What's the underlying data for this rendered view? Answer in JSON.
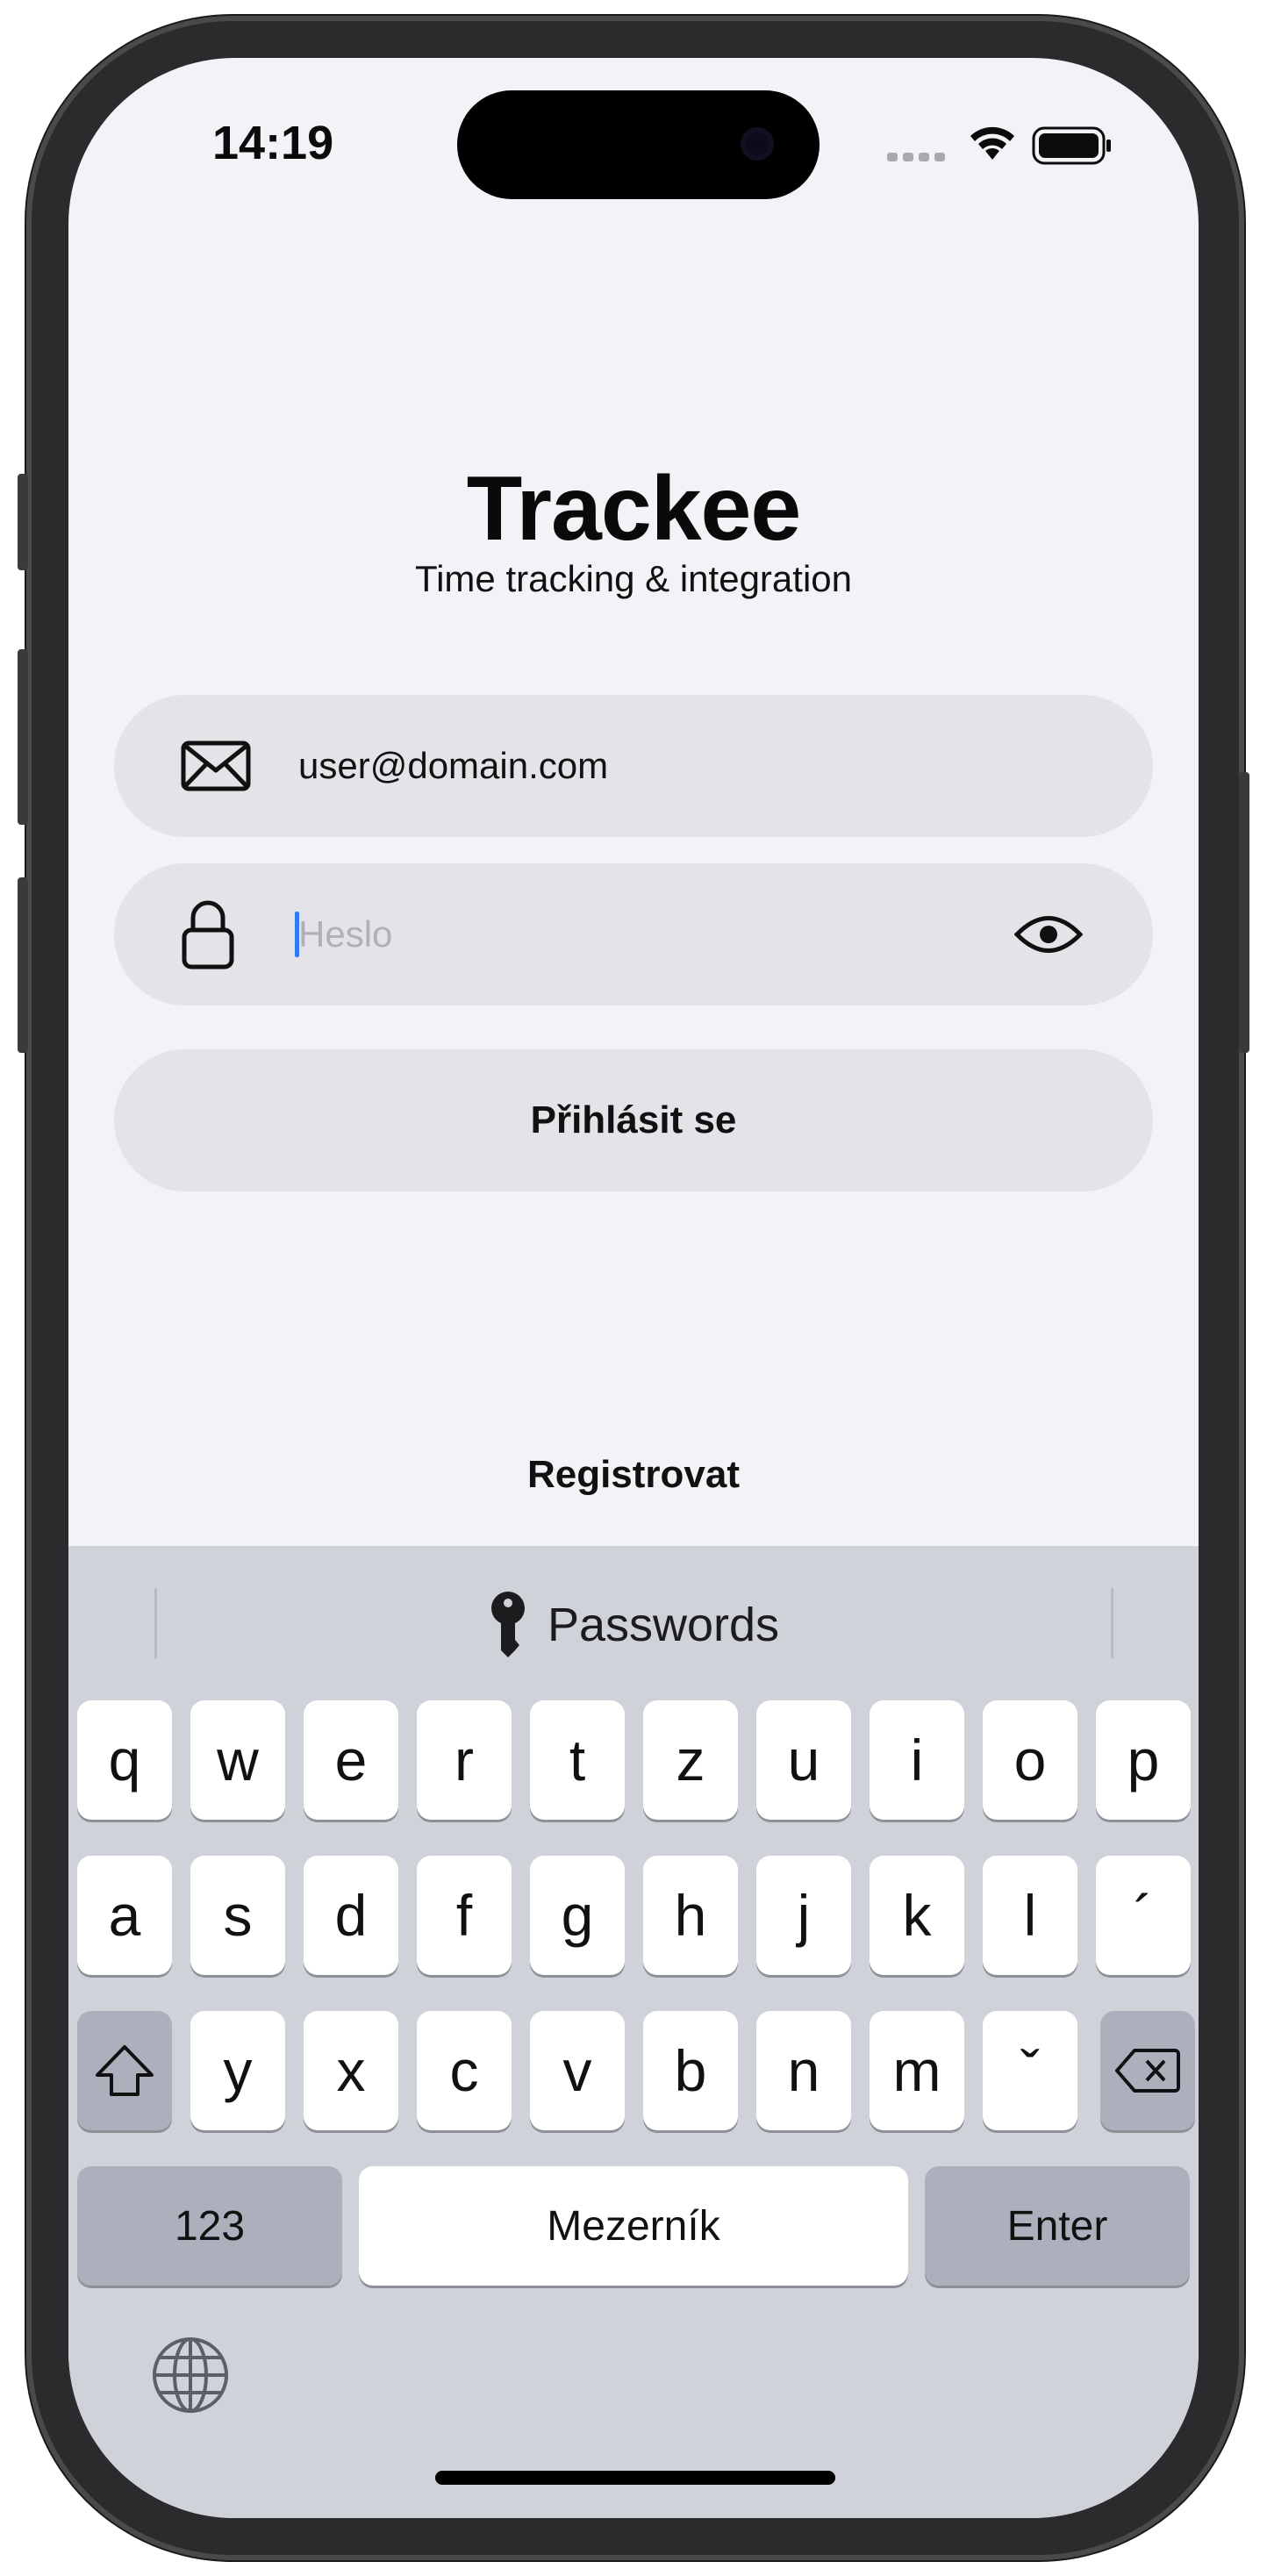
{
  "status_bar": {
    "time": "14:19"
  },
  "app": {
    "title": "Trackee",
    "subtitle": "Time tracking & integration"
  },
  "login_form": {
    "email_value": "user@domain.com",
    "password_placeholder": "Heslo",
    "login_button": "Přihlásit se",
    "register_link": "Registrovat"
  },
  "keyboard": {
    "suggestion": "Passwords",
    "row1": [
      "q",
      "w",
      "e",
      "r",
      "t",
      "z",
      "u",
      "i",
      "o",
      "p"
    ],
    "row2": [
      "a",
      "s",
      "d",
      "f",
      "g",
      "h",
      "j",
      "k",
      "l",
      "´"
    ],
    "row3": [
      "y",
      "x",
      "c",
      "v",
      "b",
      "n",
      "m",
      "ˇ"
    ],
    "numbers_key": "123",
    "space_key": "Mezerník",
    "return_key": "Enter"
  },
  "colors": {
    "caret": "#2f7cf6",
    "field_bg": "#e3e3e8",
    "screen_bg": "#f2f2f7",
    "keyboard_bg": "#d0d2d9"
  }
}
